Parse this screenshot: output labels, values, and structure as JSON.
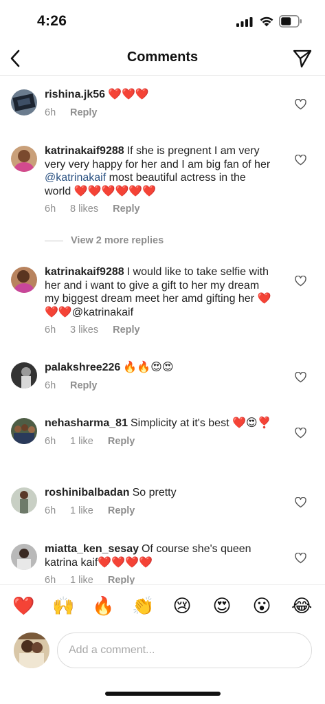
{
  "status_bar": {
    "time": "4:26"
  },
  "header": {
    "title": "Comments"
  },
  "comments": [
    {
      "username": "rishina.jk56",
      "text": "❤️❤️❤️",
      "time": "6h",
      "likes": "",
      "reply": "Reply"
    },
    {
      "username": "katrinakaif9288",
      "text_before": "If she is pregnent I am very very very happy for her and I am big fan of her ",
      "mention": "@katrinakaif",
      "text_after": " most beautiful actress in the world ❤️❤️❤️❤️❤️❤️",
      "time": "6h",
      "likes": "8 likes",
      "reply": "Reply"
    },
    {
      "username": "katrinakaif9288",
      "text": "I would like to take selfie with her and i want to give a gift to her my dream my biggest dream meet her amd gifting her ❤️❤️❤️@katrinakaif",
      "time": "6h",
      "likes": "3 likes",
      "reply": "Reply"
    },
    {
      "username": "palakshree226",
      "text": "🔥🔥😍😍",
      "time": "6h",
      "likes": "",
      "reply": "Reply"
    },
    {
      "username": "nehasharma_81",
      "text": "Simplicity at it's best ❤️😍❣️",
      "time": "6h",
      "likes": "1 like",
      "reply": "Reply"
    },
    {
      "username": "roshinibalbadan",
      "text": "So pretty",
      "time": "6h",
      "likes": "1 like",
      "reply": "Reply"
    },
    {
      "username": "miatta_ken_sesay",
      "text": "Of course she's queen katrina kaif❤️❤️❤️❤️",
      "time": "6h",
      "likes": "1 like",
      "reply": "Reply"
    }
  ],
  "more_replies": "View 2 more replies",
  "emoji_bar": [
    "❤️",
    "🙌",
    "🔥",
    "👏",
    "😢",
    "😍",
    "😮",
    "😂"
  ],
  "composer": {
    "placeholder": "Add a comment..."
  },
  "colors": {
    "accent_mention": "#2b5282",
    "secondary_text": "#8e8e8e",
    "heart_red": "#e0213a"
  }
}
